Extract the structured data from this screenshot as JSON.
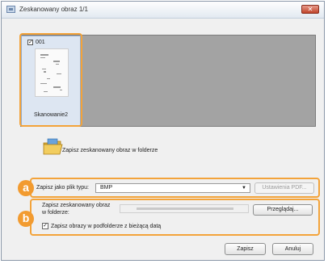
{
  "window": {
    "title": "Zeskanowany obraz 1/1",
    "close_glyph": "✕"
  },
  "thumbnail": {
    "checked_glyph": "✓",
    "number": "001",
    "name": "Skanowanie2"
  },
  "save_folder": {
    "label": "Zapisz zeskanowany obraz w folderze"
  },
  "markers": {
    "a": "a",
    "b": "b"
  },
  "file_type": {
    "label": "Zapisz jako plik typu:",
    "value": "BMP",
    "arrow": "▼",
    "pdf_settings_label": "Ustawienia PDF..."
  },
  "folder": {
    "label_line1": "Zapisz zeskanowany obraz",
    "label_line2": "w folderze:",
    "browse_label": "Przeglądaj..."
  },
  "subfolder": {
    "checked_glyph": "✓",
    "label": "Zapisz obrazy w podfolderze z bieżącą datą"
  },
  "buttons": {
    "save_label": "Zapisz",
    "cancel_label": "Anuluj"
  },
  "colors": {
    "highlight": "#f3a33a",
    "marker": "#f29b30"
  }
}
